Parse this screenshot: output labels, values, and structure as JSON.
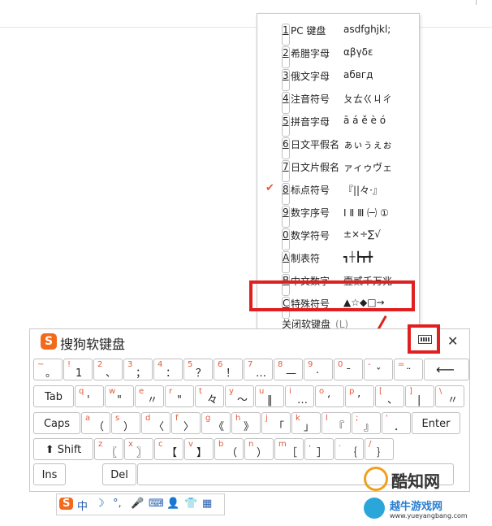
{
  "menu": {
    "items": [
      {
        "key": "1",
        "label": "PC 键盘",
        "sample": "asdfghjkl;",
        "checked": false
      },
      {
        "key": "2",
        "label": "希腊字母",
        "sample": "αβγδε",
        "checked": false
      },
      {
        "key": "3",
        "label": "俄文字母",
        "sample": "абвгд",
        "checked": false
      },
      {
        "key": "4",
        "label": "注音符号",
        "sample": "ㄆㄊㄍㄐㄔ",
        "checked": false
      },
      {
        "key": "5",
        "label": "拼音字母",
        "sample": "ā á ě è ó",
        "checked": false
      },
      {
        "key": "6",
        "label": "日文平假名",
        "sample": "ぁぃぅぇぉ",
        "checked": false
      },
      {
        "key": "7",
        "label": "日文片假名",
        "sample": "ァィゥヴェ",
        "checked": false
      },
      {
        "key": "8",
        "label": "标点符号",
        "sample": "『||々·』",
        "checked": true
      },
      {
        "key": "9",
        "label": "数字序号",
        "sample": "Ⅰ Ⅱ Ⅲ ㈠ ①",
        "checked": false
      },
      {
        "key": "0",
        "label": "数学符号",
        "sample": "±×÷∑√",
        "checked": false
      },
      {
        "key": "A",
        "label": "制表符",
        "sample": "┓┼┣┳╋",
        "checked": false
      },
      {
        "key": "B",
        "label": "中文数字",
        "sample": "壹贰千万兆",
        "checked": false
      },
      {
        "key": "C",
        "label": "特殊符号",
        "sample": "▲☆◆□→",
        "checked": false
      }
    ],
    "close_label": "关闭软键盘",
    "close_hint": "(L)"
  },
  "keyboard": {
    "title": "搜狗软键盘",
    "logo": "S",
    "close": "✕",
    "rows": [
      [
        {
          "top": "~",
          "bot": "。"
        },
        {
          "top": "!",
          "bot": "1"
        },
        {
          "top": "2",
          "bot": "、"
        },
        {
          "top": "3",
          "bot": "；"
        },
        {
          "top": "4",
          "bot": "："
        },
        {
          "top": "5",
          "bot": "？"
        },
        {
          "top": "6",
          "bot": "！"
        },
        {
          "top": "7",
          "bot": "…"
        },
        {
          "top": "8",
          "bot": "—"
        },
        {
          "top": "9",
          "bot": "·"
        },
        {
          "top": "0",
          "bot": "ˉ"
        },
        {
          "top": "-",
          "bot": "ˇ"
        },
        {
          "top": "=",
          "bot": "¨"
        },
        {
          "top": "",
          "bot": "⟵",
          "special": "back"
        }
      ],
      [
        {
          "label": "Tab"
        },
        {
          "top": "q",
          "bot": "'"
        },
        {
          "top": "w",
          "bot": "\""
        },
        {
          "top": "e",
          "bot": "〃"
        },
        {
          "top": "r",
          "bot": "\""
        },
        {
          "top": "t",
          "bot": "々"
        },
        {
          "top": "y",
          "bot": "～"
        },
        {
          "top": "u",
          "bot": "‖"
        },
        {
          "top": "i",
          "bot": "…"
        },
        {
          "top": "o",
          "bot": "‘"
        },
        {
          "top": "p",
          "bot": "’"
        },
        {
          "top": "[",
          "bot": "、"
        },
        {
          "top": "]",
          "bot": "|"
        },
        {
          "top": "\\",
          "bot": "〃"
        }
      ],
      [
        {
          "label": "Caps"
        },
        {
          "top": "a",
          "bot": "（"
        },
        {
          "top": "s",
          "bot": "）"
        },
        {
          "top": "d",
          "bot": "〈"
        },
        {
          "top": "f",
          "bot": "〉"
        },
        {
          "top": "g",
          "bot": "《"
        },
        {
          "top": "h",
          "bot": "》"
        },
        {
          "top": "j",
          "bot": "「"
        },
        {
          "top": "k",
          "bot": "」"
        },
        {
          "top": "l",
          "bot": "『"
        },
        {
          "top": ";",
          "bot": "』"
        },
        {
          "top": "'",
          "bot": "．"
        },
        {
          "label": "Enter"
        }
      ],
      [
        {
          "label": "⬆ Shift"
        },
        {
          "top": "z",
          "bot": "〖"
        },
        {
          "top": "x",
          "bot": "〗"
        },
        {
          "top": "c",
          "bot": "【"
        },
        {
          "top": "v",
          "bot": "】"
        },
        {
          "top": "b",
          "bot": "（"
        },
        {
          "top": "n",
          "bot": "）"
        },
        {
          "top": "m",
          "bot": "［"
        },
        {
          "top": ",",
          "bot": "］"
        },
        {
          "top": ".",
          "bot": "｛"
        },
        {
          "top": "/",
          "bot": "｝"
        }
      ],
      [
        {
          "label": "Ins"
        },
        {
          "label": "Del"
        },
        {
          "label": ""
        }
      ]
    ]
  },
  "statusbar": {
    "items": [
      "S",
      "中",
      "☽",
      "°,",
      "🎤",
      "⌨",
      "👤",
      "👕",
      "▦"
    ]
  },
  "watermark": {
    "name": "酷知网",
    "site_cn": "越牛游戏网",
    "site_url": "www.yueyangbang.com"
  },
  "colors": {
    "accent": "#e02020",
    "brand": "#f26a1b",
    "key_label": "#e05b3a"
  }
}
